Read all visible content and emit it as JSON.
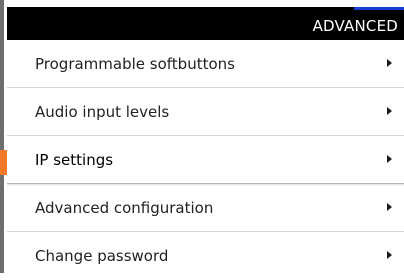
{
  "header": {
    "title": "ADVANCED",
    "accent_color": "#1a3fd0",
    "background": "#000000"
  },
  "menu": {
    "selected_index": 2,
    "highlight_color": "#f0792a",
    "items": [
      {
        "label": "Programmable softbuttons",
        "icon": "chevron-right-icon"
      },
      {
        "label": "Audio input levels",
        "icon": "chevron-right-icon"
      },
      {
        "label": "IP settings",
        "icon": "chevron-right-icon"
      },
      {
        "label": "Advanced configuration",
        "icon": "chevron-right-icon"
      },
      {
        "label": "Change password",
        "icon": "chevron-right-icon"
      }
    ]
  }
}
